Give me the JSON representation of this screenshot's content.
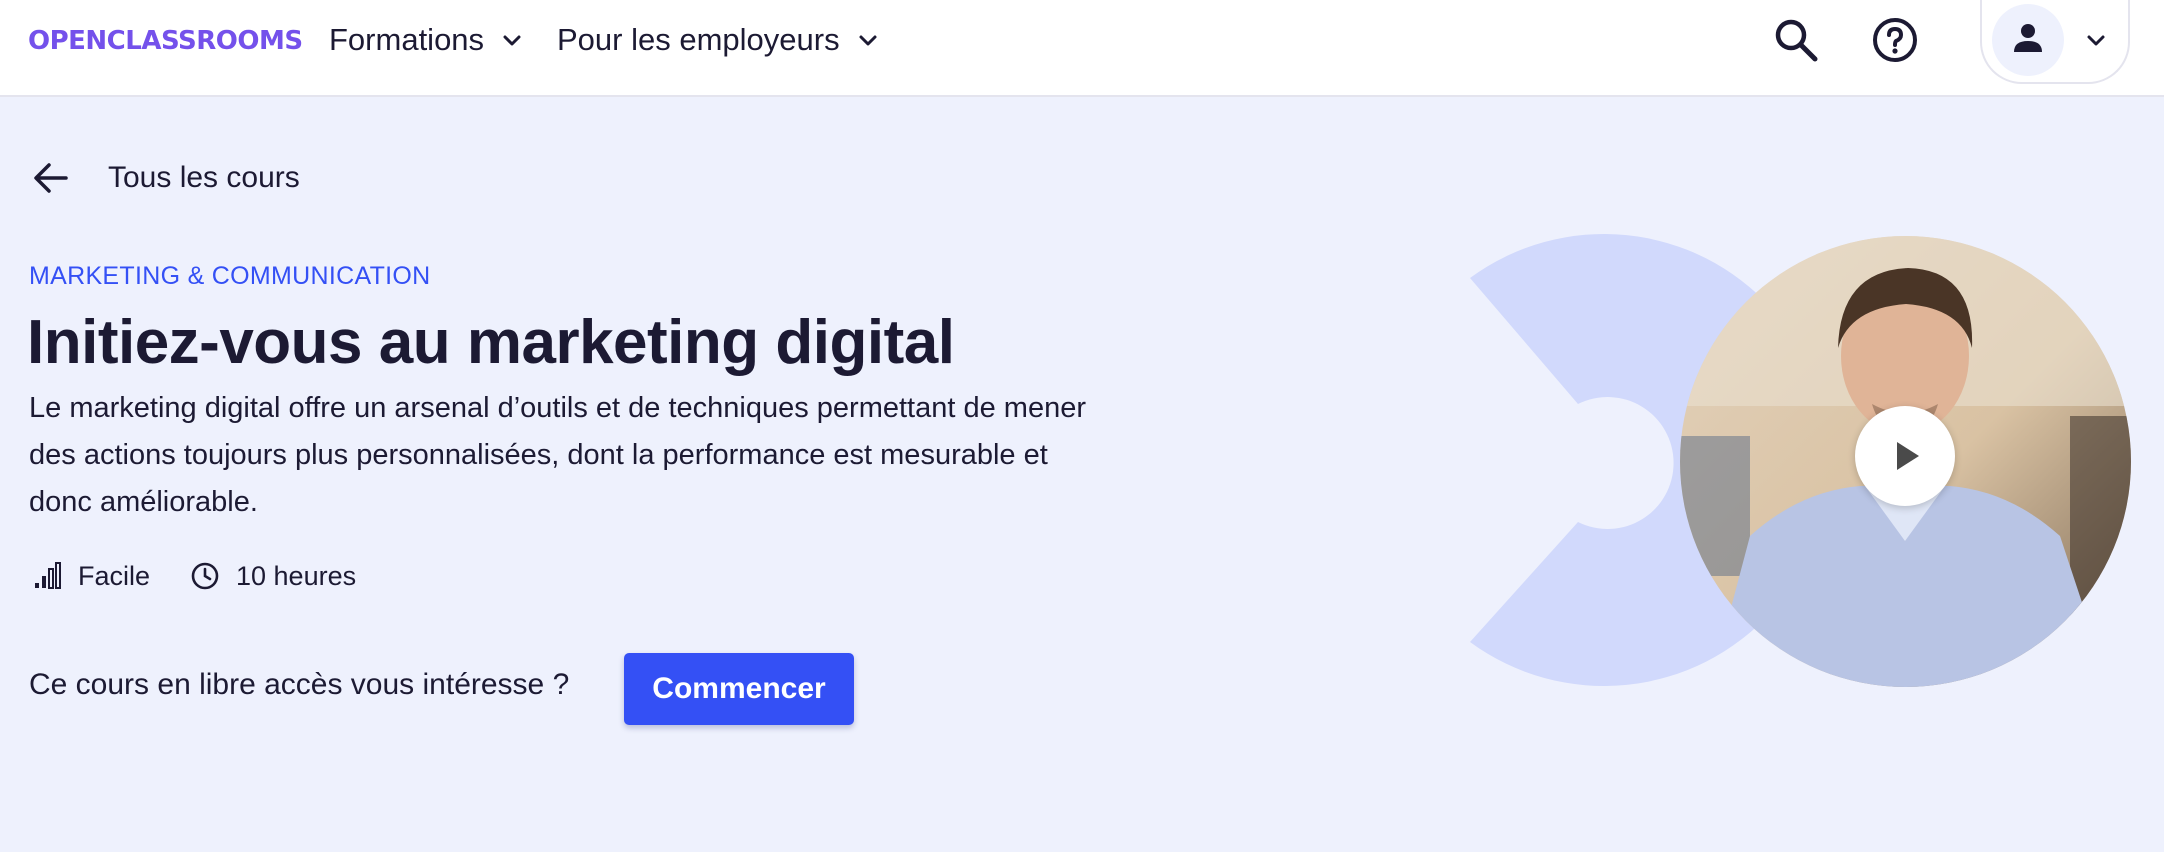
{
  "header": {
    "logo": "OPENCLASSROOMS",
    "nav": [
      {
        "label": "Formations"
      },
      {
        "label": "Pour les employeurs"
      }
    ]
  },
  "back_link": {
    "label": "Tous les cours"
  },
  "course": {
    "category": "MARKETING & COMMUNICATION",
    "title": "Initiez-vous au marketing digital",
    "description": "Le marketing digital offre un arsenal d’outils et de techniques permettant de mener des actions toujours plus personnalisées, dont la performance est mesurable et donc améliorable.",
    "level": "Facile",
    "duration": "10 heures"
  },
  "cta": {
    "text": "Ce cours en libre accès vous intéresse ?",
    "button": "Commencer"
  },
  "colors": {
    "brand_logo": "#7451eb",
    "accent": "#3450f5",
    "page_bg": "#eef1fd",
    "deco": "#d1d9fc",
    "text": "#1c1a33"
  },
  "icons": [
    "chevron-down-icon",
    "search-icon",
    "help-icon",
    "user-icon",
    "arrow-left-icon",
    "level-bars-icon",
    "clock-icon",
    "play-icon"
  ]
}
